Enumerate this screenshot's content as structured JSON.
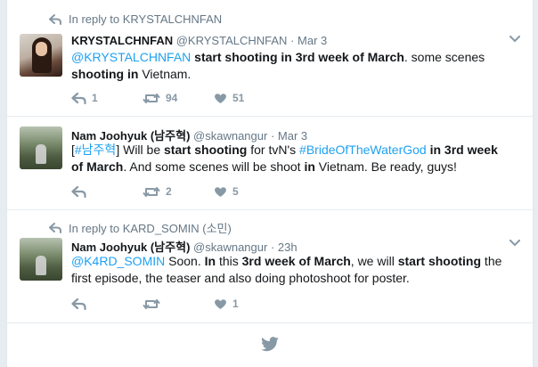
{
  "colors": {
    "link": "#1da1f2",
    "muted": "#657786",
    "icon": "#8899a6",
    "bg": "#e6ecf0"
  },
  "tweets": [
    {
      "reply_context": "In reply to KRYSTALCHNFAN",
      "name": "KRYSTALCHNFAN",
      "handle": "@KRYSTALCHNFAN",
      "dot": "·",
      "time": "Mar 3",
      "text_parts": [
        "@KRYSTALCHNFAN",
        " ",
        "start shooting in 3rd week of March",
        ". some scenes ",
        "shooting in",
        " Vietnam."
      ],
      "replies": "1",
      "retweets": "94",
      "likes": "51"
    },
    {
      "name": "Nam Joohyuk (남주혁)",
      "handle": "@skawnangur",
      "dot": "·",
      "time": "Mar 3",
      "text_parts": [
        "[",
        "#남주혁",
        "] Will be ",
        "start shooting",
        " for tvN's ",
        "#BrideOfTheWaterGod",
        " ",
        "in 3rd week of March",
        ". And some scenes will be shoot ",
        "in",
        " Vietnam. Be ready, guys!"
      ],
      "retweets": "2",
      "likes": "5"
    },
    {
      "reply_context": "In reply to KARD_SOMIN (소민)",
      "name": "Nam Joohyuk (남주혁)",
      "handle": "@skawnangur",
      "dot": "·",
      "time": "23h",
      "text_parts": [
        "@K4RD_SOMIN",
        " Soon. ",
        "In",
        " this ",
        "3rd week of March",
        ", we will ",
        "start shooting",
        " the first episode, the teaser and also doing photoshoot for poster."
      ],
      "likes": "1"
    }
  ]
}
